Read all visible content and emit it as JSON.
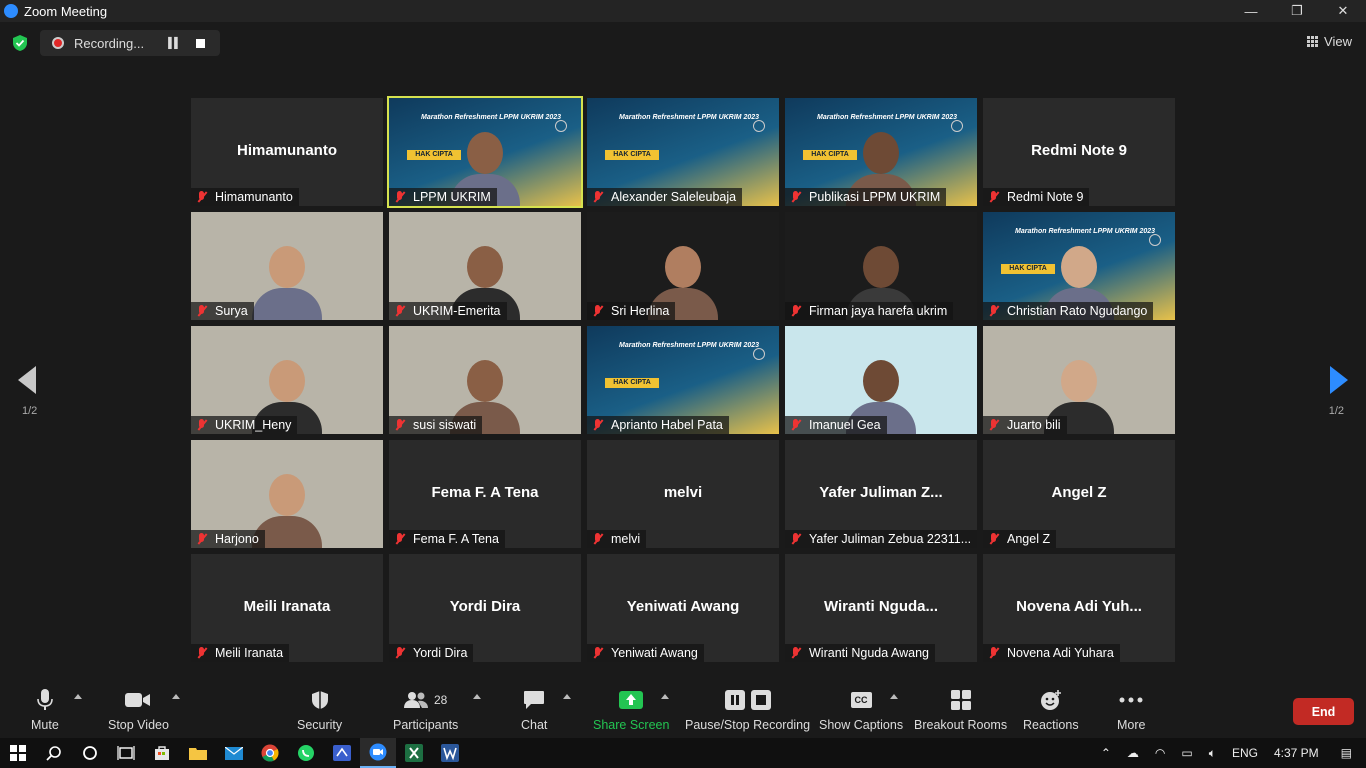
{
  "window": {
    "title": "Zoom Meeting",
    "minimize": "—",
    "restore": "❐",
    "close": "✕"
  },
  "topbar": {
    "recording_label": "Recording...",
    "view_label": "View"
  },
  "participants": [
    {
      "display": "Himamunanto",
      "label": "Himamunanto",
      "video": false
    },
    {
      "display": "",
      "label": "LPPM UKRIM",
      "video": true,
      "active": true,
      "kind": "slide-person"
    },
    {
      "display": "",
      "label": "Alexander Saleleubaja",
      "video": true,
      "kind": "slide"
    },
    {
      "display": "",
      "label": "Publikasi LPPM UKRIM",
      "video": true,
      "kind": "slide-person"
    },
    {
      "display": "Redmi Note 9",
      "label": "Redmi Note 9",
      "video": false
    },
    {
      "display": "",
      "label": "Surya",
      "video": true,
      "kind": "room"
    },
    {
      "display": "",
      "label": "UKRIM-Emerita",
      "video": true,
      "kind": "room"
    },
    {
      "display": "",
      "label": "Sri Herlina",
      "video": true,
      "kind": "dark"
    },
    {
      "display": "",
      "label": "Firman jaya harefa ukrim",
      "video": true,
      "kind": "dark"
    },
    {
      "display": "",
      "label": "Christian Rato Ngudango",
      "video": true,
      "kind": "slide-person"
    },
    {
      "display": "",
      "label": "UKRIM_Heny",
      "video": true,
      "kind": "room"
    },
    {
      "display": "",
      "label": "susi siswati",
      "video": true,
      "kind": "room"
    },
    {
      "display": "",
      "label": "Aprianto Habel Pata",
      "video": true,
      "kind": "slide"
    },
    {
      "display": "",
      "label": "Imanuel Gea",
      "video": true,
      "kind": "light"
    },
    {
      "display": "",
      "label": "Juarto bili",
      "video": true,
      "kind": "room"
    },
    {
      "display": "",
      "label": "Harjono",
      "video": true,
      "kind": "room"
    },
    {
      "display": "Fema F. A Tena",
      "label": "Fema F. A Tena",
      "video": false
    },
    {
      "display": "melvi",
      "label": "melvi",
      "video": false
    },
    {
      "display": "Yafer Juliman Z...",
      "label": "Yafer Juliman Zebua 22311...",
      "video": false
    },
    {
      "display": "Angel Z",
      "label": "Angel Z",
      "video": false
    },
    {
      "display": "Meili Iranata",
      "label": "Meili Iranata",
      "video": false
    },
    {
      "display": "Yordi Dira",
      "label": "Yordi Dira",
      "video": false
    },
    {
      "display": "Yeniwati Awang",
      "label": "Yeniwati Awang",
      "video": false
    },
    {
      "display": "Wiranti  Nguda...",
      "label": "Wiranti Nguda Awang",
      "video": false
    },
    {
      "display": "Novena Adi Yuh...",
      "label": "Novena Adi Yuhara",
      "video": false
    }
  ],
  "slide_text": {
    "title": "Marathon Refreshment LPPM UKRIM 2023",
    "banner": "HAK CIPTA"
  },
  "paging": {
    "left": "1/2",
    "right": "1/2"
  },
  "toolbar": {
    "mute": "Mute",
    "stop_video": "Stop Video",
    "security": "Security",
    "participants": "Participants",
    "participants_count": "28",
    "chat": "Chat",
    "share_screen": "Share Screen",
    "pause_stop_recording": "Pause/Stop Recording",
    "captions": "Show Captions",
    "captions_icon": "CC",
    "breakout": "Breakout Rooms",
    "reactions": "Reactions",
    "more": "More",
    "end": "End"
  },
  "taskbar": {
    "lang": "ENG",
    "time": "4:37 PM"
  },
  "colors": {
    "accent": "#2d8cff",
    "end": "#c22a24",
    "active_speaker": "#d6e24f",
    "share": "#23c552"
  }
}
